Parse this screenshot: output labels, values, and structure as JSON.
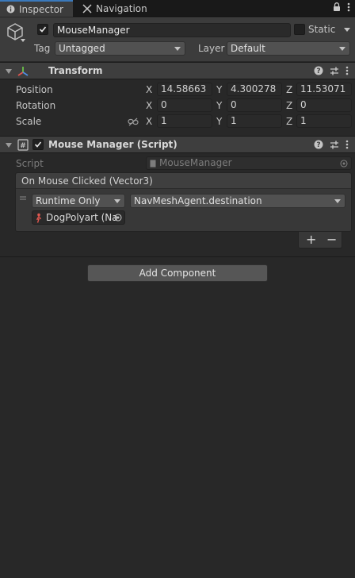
{
  "tabs": [
    {
      "label": "Inspector",
      "icon": "info-icon"
    },
    {
      "label": "Navigation",
      "icon": "navigation-icon"
    }
  ],
  "gameobject": {
    "name": "MouseManager",
    "static_label": "Static",
    "tag_label": "Tag",
    "tag_value": "Untagged",
    "layer_label": "Layer",
    "layer_value": "Default"
  },
  "transform": {
    "title": "Transform",
    "position_label": "Position",
    "rotation_label": "Rotation",
    "scale_label": "Scale",
    "axis_x": "X",
    "axis_y": "Y",
    "axis_z": "Z",
    "position": [
      "14.58663",
      "4.300278",
      "11.53071"
    ],
    "rotation": [
      "0",
      "0",
      "0"
    ],
    "scale": [
      "1",
      "1",
      "1"
    ]
  },
  "mouse_manager": {
    "title": "Mouse Manager (Script)",
    "script_label": "Script",
    "script_value": "MouseManager",
    "event_title": "On Mouse Clicked (Vector3)",
    "runtime_value": "Runtime Only",
    "function_value": "NavMeshAgent.destination",
    "object_value": "DogPolyart (Na",
    "plus_label": "+",
    "minus_label": "−"
  },
  "add_component_label": "Add Component",
  "colors": {
    "accent": "#3a79bb",
    "background": "#282828",
    "header": "#3e3e3e"
  }
}
